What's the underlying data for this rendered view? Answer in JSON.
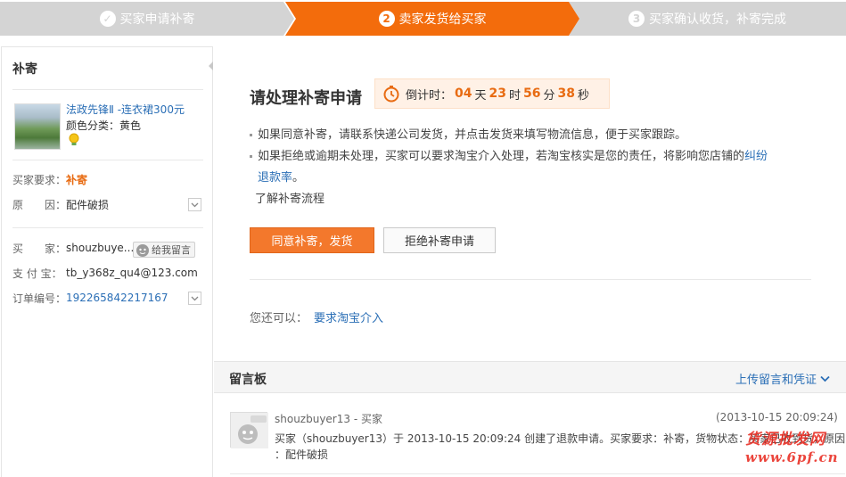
{
  "steps": [
    {
      "num": "✓",
      "label": "买家申请补寄"
    },
    {
      "num": "2",
      "label": "卖家发货给买家"
    },
    {
      "num": "3",
      "label": "买家确认收货，补寄完成"
    }
  ],
  "sidebar": {
    "title": "补寄",
    "product_link": "法政先锋Ⅱ -连衣裙300元",
    "product_spec": "颜色分类：黄色",
    "buyer_req_label": "买家要求：",
    "buyer_req_value": "补寄",
    "reason_label": "原　　因：",
    "reason_value": "配件破损",
    "buyer_label": "买　　家：",
    "buyer_value": "shouzbuye...",
    "leave_msg": "给我留言",
    "alipay_label": "支 付 宝：",
    "alipay_value": "tb_y368z_qu4@123.com",
    "order_label": "订单编号：",
    "order_value": "192265842217167"
  },
  "main": {
    "title": "请处理补寄申请",
    "countdown": {
      "label": "倒计时：",
      "days": "04",
      "days_unit": "天",
      "hours": "23",
      "hours_unit": "时",
      "minutes": "56",
      "minutes_unit": "分",
      "seconds": "38",
      "seconds_unit": "秒"
    },
    "info1": "如果同意补寄，请联系快递公司发货，并点击发货来填写物流信息，便于买家跟踪。",
    "info2_a": "如果拒绝或逾期未处理，买家可以要求淘宝介入处理，若淘宝核实是您的责任，将影响您店铺的",
    "info2_link_a": "纠纷",
    "info2_link_b": "退款率",
    "info2_end": "。",
    "learn": "了解补寄流程",
    "agree_btn": "同意补寄，发货",
    "refuse_btn": "拒绝补寄申请",
    "also_text": "您还可以：",
    "also_link": "要求淘宝介入"
  },
  "board": {
    "title": "留言板",
    "upload": "上传留言和凭证",
    "message": {
      "author": "shouzbuyer13 - 买家",
      "time": "(2013-10-15 20:09:24)",
      "line1": "买家（shouzbuyer13）于 2013-10-15 20:09:24 创建了退款申请。买家要求：补寄，货物状态：买家已收到货，原因",
      "line2": "：配件破损"
    }
  },
  "watermark": {
    "top": "货源批发网",
    "bottom": "www.6pf.cn"
  },
  "colors": {
    "accent": "#f36c0c",
    "link": "#2b6fb6",
    "step_inactive": "#d4d4d4"
  }
}
